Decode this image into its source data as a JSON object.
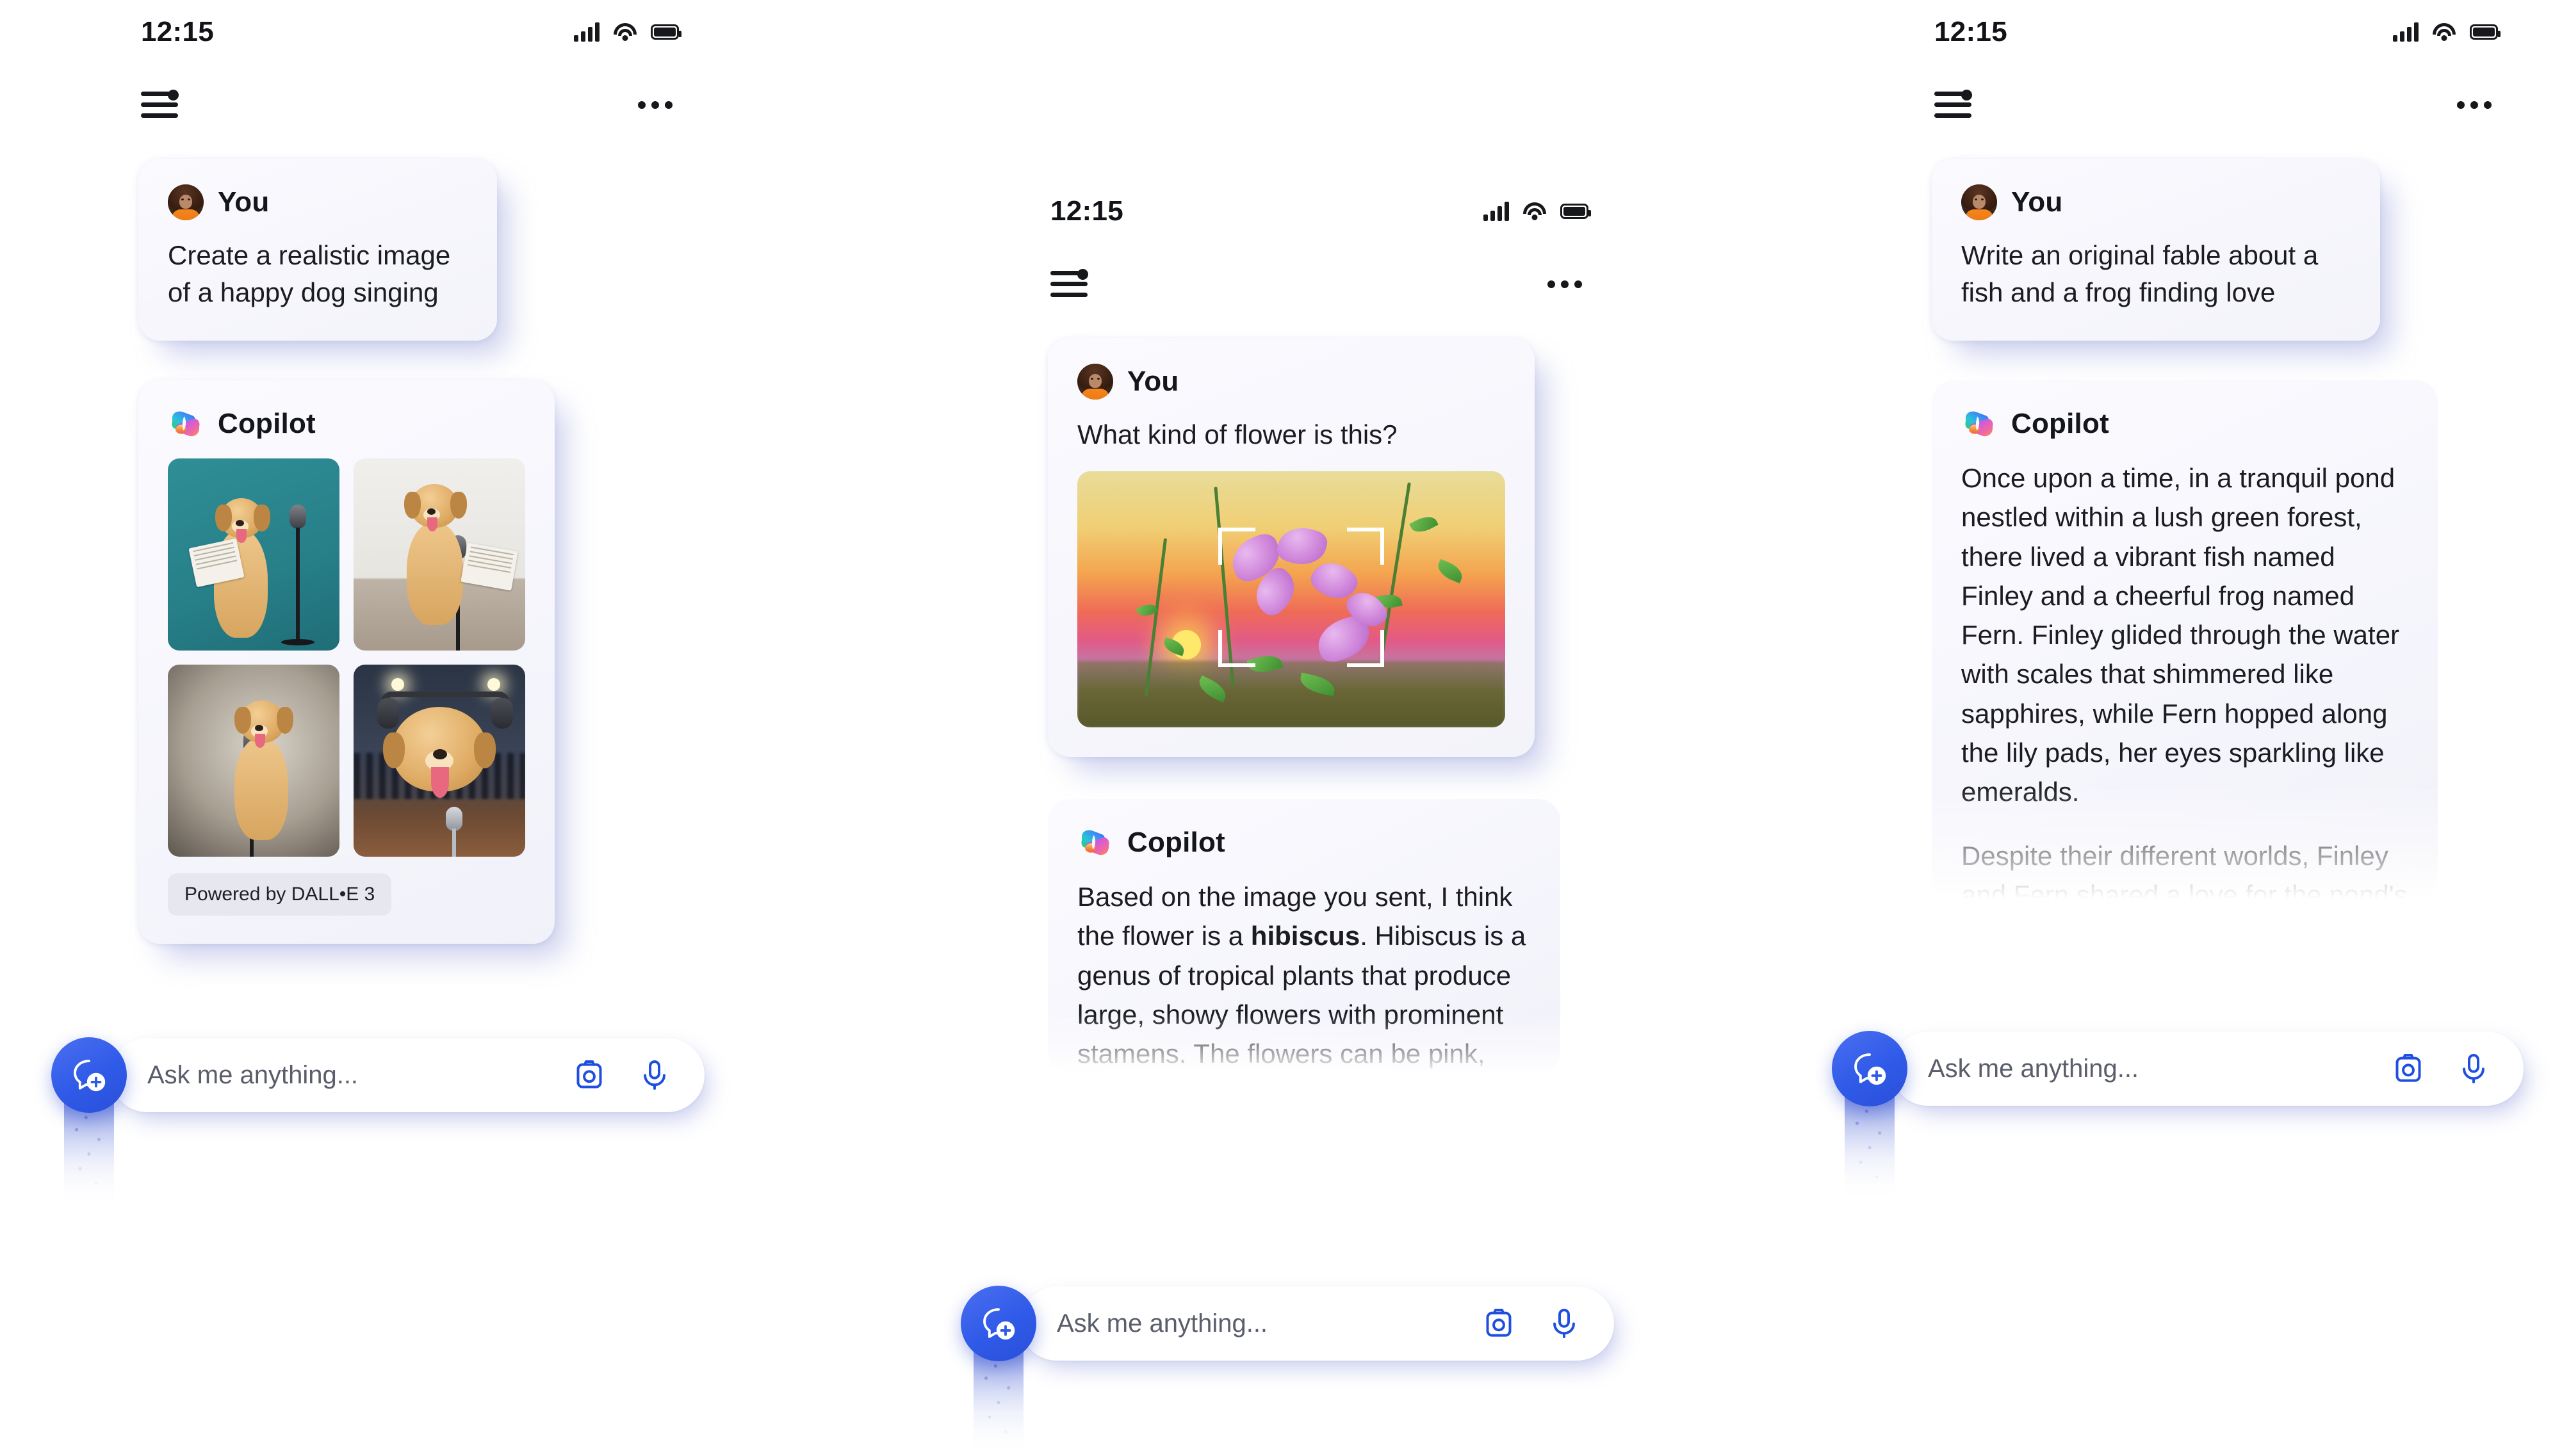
{
  "app": {
    "name": "Copilot",
    "assistant_label": "Copilot",
    "user_label": "You"
  },
  "status_bar": {
    "time": "12:15",
    "icons": [
      "cellular-signal-icon",
      "wifi-icon",
      "battery-icon"
    ]
  },
  "header": {
    "menu_icon": "sliders-menu-icon",
    "overflow_icon": "more-options-icon"
  },
  "composer": {
    "placeholder": "Ask me anything...",
    "camera_icon": "camera-icon",
    "mic_icon": "microphone-icon",
    "fab_icon": "new-chat-bubble-plus-icon"
  },
  "colors": {
    "accent_blue": "#2f5ae8",
    "card_bg": "#f6f6fc",
    "card_shadow": "#7c86d2",
    "text_primary": "#1b1c22",
    "text_muted": "#5a5d6a",
    "chip_bg": "#e7e7ef"
  },
  "panels": [
    {
      "id": "panel-1",
      "name": "image-generation-conversation",
      "user_message": "Create a realistic image of a happy dog singing",
      "bot_message_type": "image-grid",
      "images": [
        {
          "alt": "golden retriever standing singing at microphone with sheet music, teal backdrop"
        },
        {
          "alt": "golden retriever sitting singing at microphone holding sheet music, white room"
        },
        {
          "alt": "golden retriever singing at microphone on grey studio backdrop"
        },
        {
          "alt": "golden retriever wearing headphones singing at microphone on stage"
        }
      ],
      "powered_by": "Powered by DALL•E 3"
    },
    {
      "id": "panel-2",
      "name": "image-recognition-conversation",
      "user_message": "What kind of flower is this?",
      "user_image_alt": "pink hibiscus flowers against a sunset sky",
      "bot_paragraphs": [
        {
          "segments": [
            {
              "text": "Based on the image you sent, I think the flower is a ",
              "bold": false
            },
            {
              "text": "hibiscus",
              "bold": true
            },
            {
              "text": ". Hibiscus is a genus of tropical plants that produce large, showy flowers with prominent stamens. The flowers can be pink, red, yellow, orange, or white, and they often have a contrasting eye in the",
              "bold": false
            }
          ]
        }
      ]
    },
    {
      "id": "panel-3",
      "name": "creative-writing-conversation",
      "user_message": "Write an original fable about a fish and a frog finding love",
      "bot_paragraphs": [
        "Once upon a time, in a tranquil pond nestled within a lush green forest, there lived a vibrant fish named Finley and a cheerful frog named Fern. Finley glided through the water with scales that shimmered like sapphires, while Fern hopped along the lily pads, her eyes sparkling like emeralds.",
        "Despite their different worlds, Finley and Fern shared a love for the pond's melody at dusk. Each evening, as the sun dipped below"
      ]
    }
  ]
}
